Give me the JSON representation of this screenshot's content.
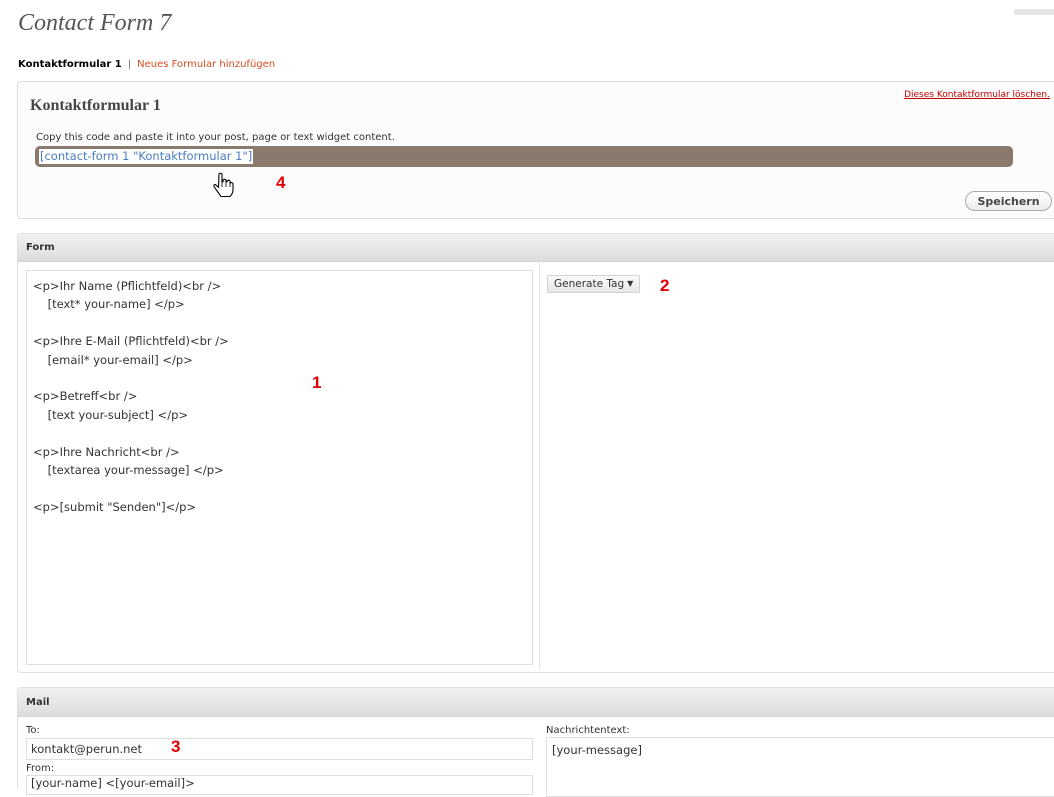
{
  "app": {
    "title": "Contact Form 7"
  },
  "subnav": {
    "current": "Kontaktformular 1",
    "separator": "|",
    "add_new": "Neues Formular hinzufügen"
  },
  "form_box": {
    "name": "Kontaktformular 1",
    "delete_label": "Dieses Kontaktformular löschen.",
    "copy_hint": "Copy this code and paste it into your post, page or text widget content.",
    "shortcode": "[contact-form 1 \"Kontaktformular 1\"]",
    "save_label": "Speichern"
  },
  "form_section": {
    "title": "Form",
    "code": "<p>Ihr Name (Pflichtfeld)<br />\n    [text* your-name] </p>\n\n<p>Ihre E-Mail (Pflichtfeld)<br />\n    [email* your-email] </p>\n\n<p>Betreff<br />\n    [text your-subject] </p>\n\n<p>Ihre Nachricht<br />\n    [textarea your-message] </p>\n\n<p>[submit \"Senden\"]</p>",
    "generate_tag_label": "Generate Tag",
    "generate_tag_arrow": "▼"
  },
  "mail_section": {
    "title": "Mail",
    "to_label": "To:",
    "to_value": "kontakt@perun.net",
    "from_label": "From:",
    "from_value": "[your-name] <[your-email]>",
    "body_label": "Nachrichtentext:",
    "body_value": "[your-message]"
  },
  "annotations": {
    "n1": "1",
    "n2": "2",
    "n3": "3",
    "n4": "4"
  },
  "colors": {
    "shortcode_highlight": "#8a7a6d",
    "link": "#d54e21",
    "delete": "#cc0000",
    "annotation": "#e00000"
  }
}
